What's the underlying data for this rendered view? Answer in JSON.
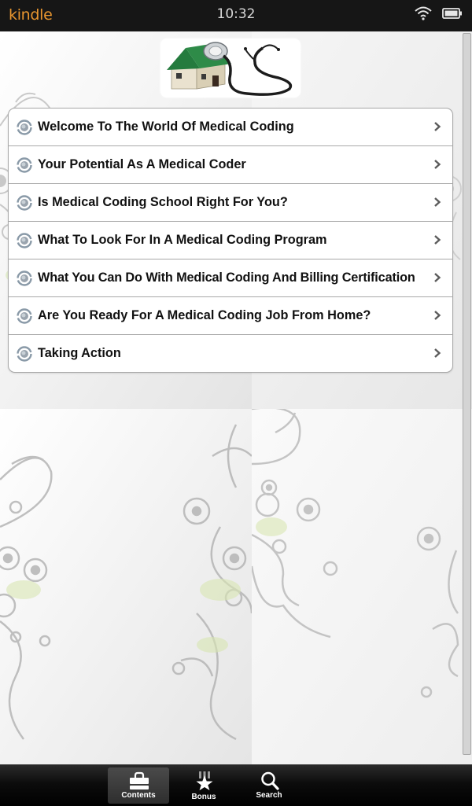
{
  "status_bar": {
    "app_name": "kindle",
    "time": "10:32",
    "icons": [
      "wifi-icon",
      "battery-icon"
    ]
  },
  "header": {
    "logo": "house-with-stethoscope-logo"
  },
  "menu": {
    "items": [
      {
        "label": "Welcome To The World Of Medical Coding",
        "icon": "radio-bullet-icon"
      },
      {
        "label": "Your Potential As A Medical Coder",
        "icon": "radio-bullet-icon"
      },
      {
        "label": "Is Medical Coding School Right For You?",
        "icon": "radio-bullet-icon"
      },
      {
        "label": "What To Look For In A Medical Coding Program",
        "icon": "radio-bullet-icon"
      },
      {
        "label": "What You Can Do With Medical Coding And Billing Certification",
        "icon": "radio-bullet-icon"
      },
      {
        "label": "Are You Ready For A Medical Coding Job From Home?",
        "icon": "radio-bullet-icon"
      },
      {
        "label": "Taking Action",
        "icon": "radio-bullet-icon"
      }
    ]
  },
  "tab_bar": {
    "tabs": [
      {
        "label": "Contents",
        "icon": "briefcase-icon",
        "active": true
      },
      {
        "label": "Bonus",
        "icon": "medal-star-icon",
        "active": false
      },
      {
        "label": "Search",
        "icon": "search-icon",
        "active": false
      }
    ]
  },
  "colors": {
    "kindle_brand": "#e8962f",
    "status_bar_bg": "#161616",
    "list_border": "#a8a8a8",
    "logo_roof": "#1f7a3a"
  }
}
